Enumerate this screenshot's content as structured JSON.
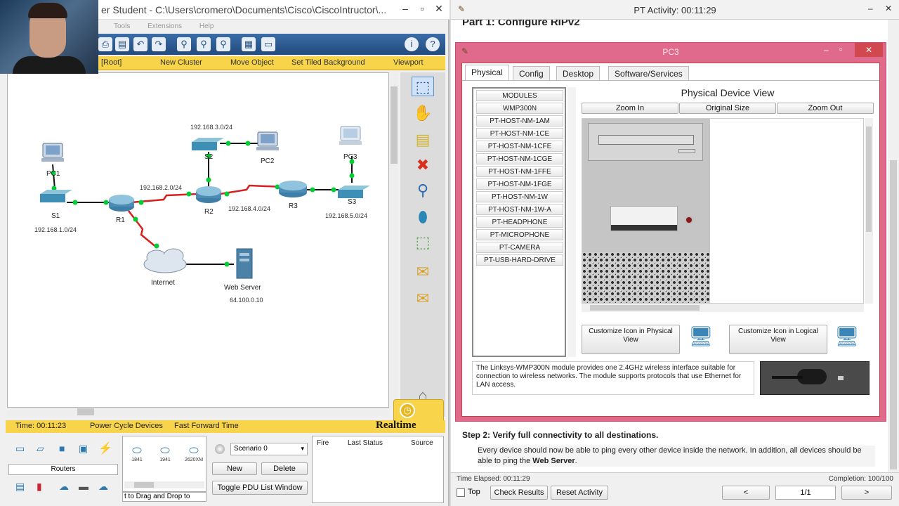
{
  "left_window": {
    "title": "er Student - C:\\Users\\cromero\\Documents\\Cisco\\CiscoIntructor\\...",
    "menu": [
      "Tools",
      "Extensions",
      "Help"
    ],
    "logical_bar": [
      "[Root]",
      "New Cluster",
      "Move Object",
      "Set Tiled Background",
      "Viewport"
    ],
    "topology": {
      "labels": {
        "pc1": "PC1",
        "pc2": "PC2",
        "pc3": "PC3",
        "s1": "S1",
        "s2": "S2",
        "s3": "S3",
        "r1": "R1",
        "r2": "R2",
        "r3": "R3",
        "internet": "Internet",
        "webserver": "Web Server"
      },
      "networks": {
        "n1": "192.168.1.0/24",
        "n2": "192.168.2.0/24",
        "n3": "192.168.3.0/24",
        "n4": "192.168.4.0/24",
        "n5": "192.168.5.0/24",
        "web_ip": "64.100.0.10"
      }
    },
    "status": {
      "time": "Time: 00:11:23",
      "power_cycle": "Power Cycle Devices",
      "fast_forward": "Fast Forward Time",
      "mode": "Realtime"
    },
    "device_panel": {
      "category": "Routers",
      "models": [
        "1841",
        "1941",
        "2620XM"
      ],
      "hint": "t to Drag and Drop to"
    },
    "scenario": {
      "selected": "Scenario 0",
      "new_label": "New",
      "delete_label": "Delete",
      "toggle_label": "Toggle PDU List Window"
    },
    "pdu_columns": [
      "Fire",
      "Last Status",
      "Source"
    ]
  },
  "right_window": {
    "title": "PT Activity: 00:11:29",
    "part_heading": "Part 1:  Configure RIPv2",
    "pc3": {
      "title": "PC3",
      "tabs": [
        "Physical",
        "Config",
        "Desktop",
        "Software/Services"
      ],
      "active_tab": "Physical",
      "modules": [
        "MODULES",
        "WMP300N",
        "PT-HOST-NM-1AM",
        "PT-HOST-NM-1CE",
        "PT-HOST-NM-1CFE",
        "PT-HOST-NM-1CGE",
        "PT-HOST-NM-1FFE",
        "PT-HOST-NM-1FGE",
        "PT-HOST-NM-1W",
        "PT-HOST-NM-1W-A",
        "PT-HEADPHONE",
        "PT-MICROPHONE",
        "PT-CAMERA",
        "PT-USB-HARD-DRIVE"
      ],
      "view_title": "Physical Device View",
      "zoom_in": "Zoom In",
      "original_size": "Original Size",
      "zoom_out": "Zoom Out",
      "customize_physical": "Customize Icon in Physical View",
      "customize_logical": "Customize Icon in Logical View",
      "description": "The Linksys-WMP300N module provides one 2.4GHz wireless interface suitable for connection to wireless networks. The module supports protocols that use Ethernet for LAN access."
    },
    "step2": {
      "heading": "Step 2:  Verify full connectivity to all destinations.",
      "text_a": "Every device should now be able to ping every other device inside the network. In addition, all devices should be able to ping the ",
      "text_b": "Web Server",
      "text_c": "."
    },
    "footer": {
      "time_elapsed": "Time Elapsed: 00:11:29",
      "completion": "Completion: 100/100",
      "top_label": "Top",
      "check_results": "Check Results",
      "reset_activity": "Reset Activity",
      "prev": "<",
      "page": "1/1",
      "next": ">"
    }
  },
  "colors": {
    "toolbar_blue": "#2d5f95",
    "yellow_bar": "#f7d44a",
    "pc3_frame": "#e06a8c",
    "link_green": "#00cc33",
    "serial_red": "#d62020"
  }
}
